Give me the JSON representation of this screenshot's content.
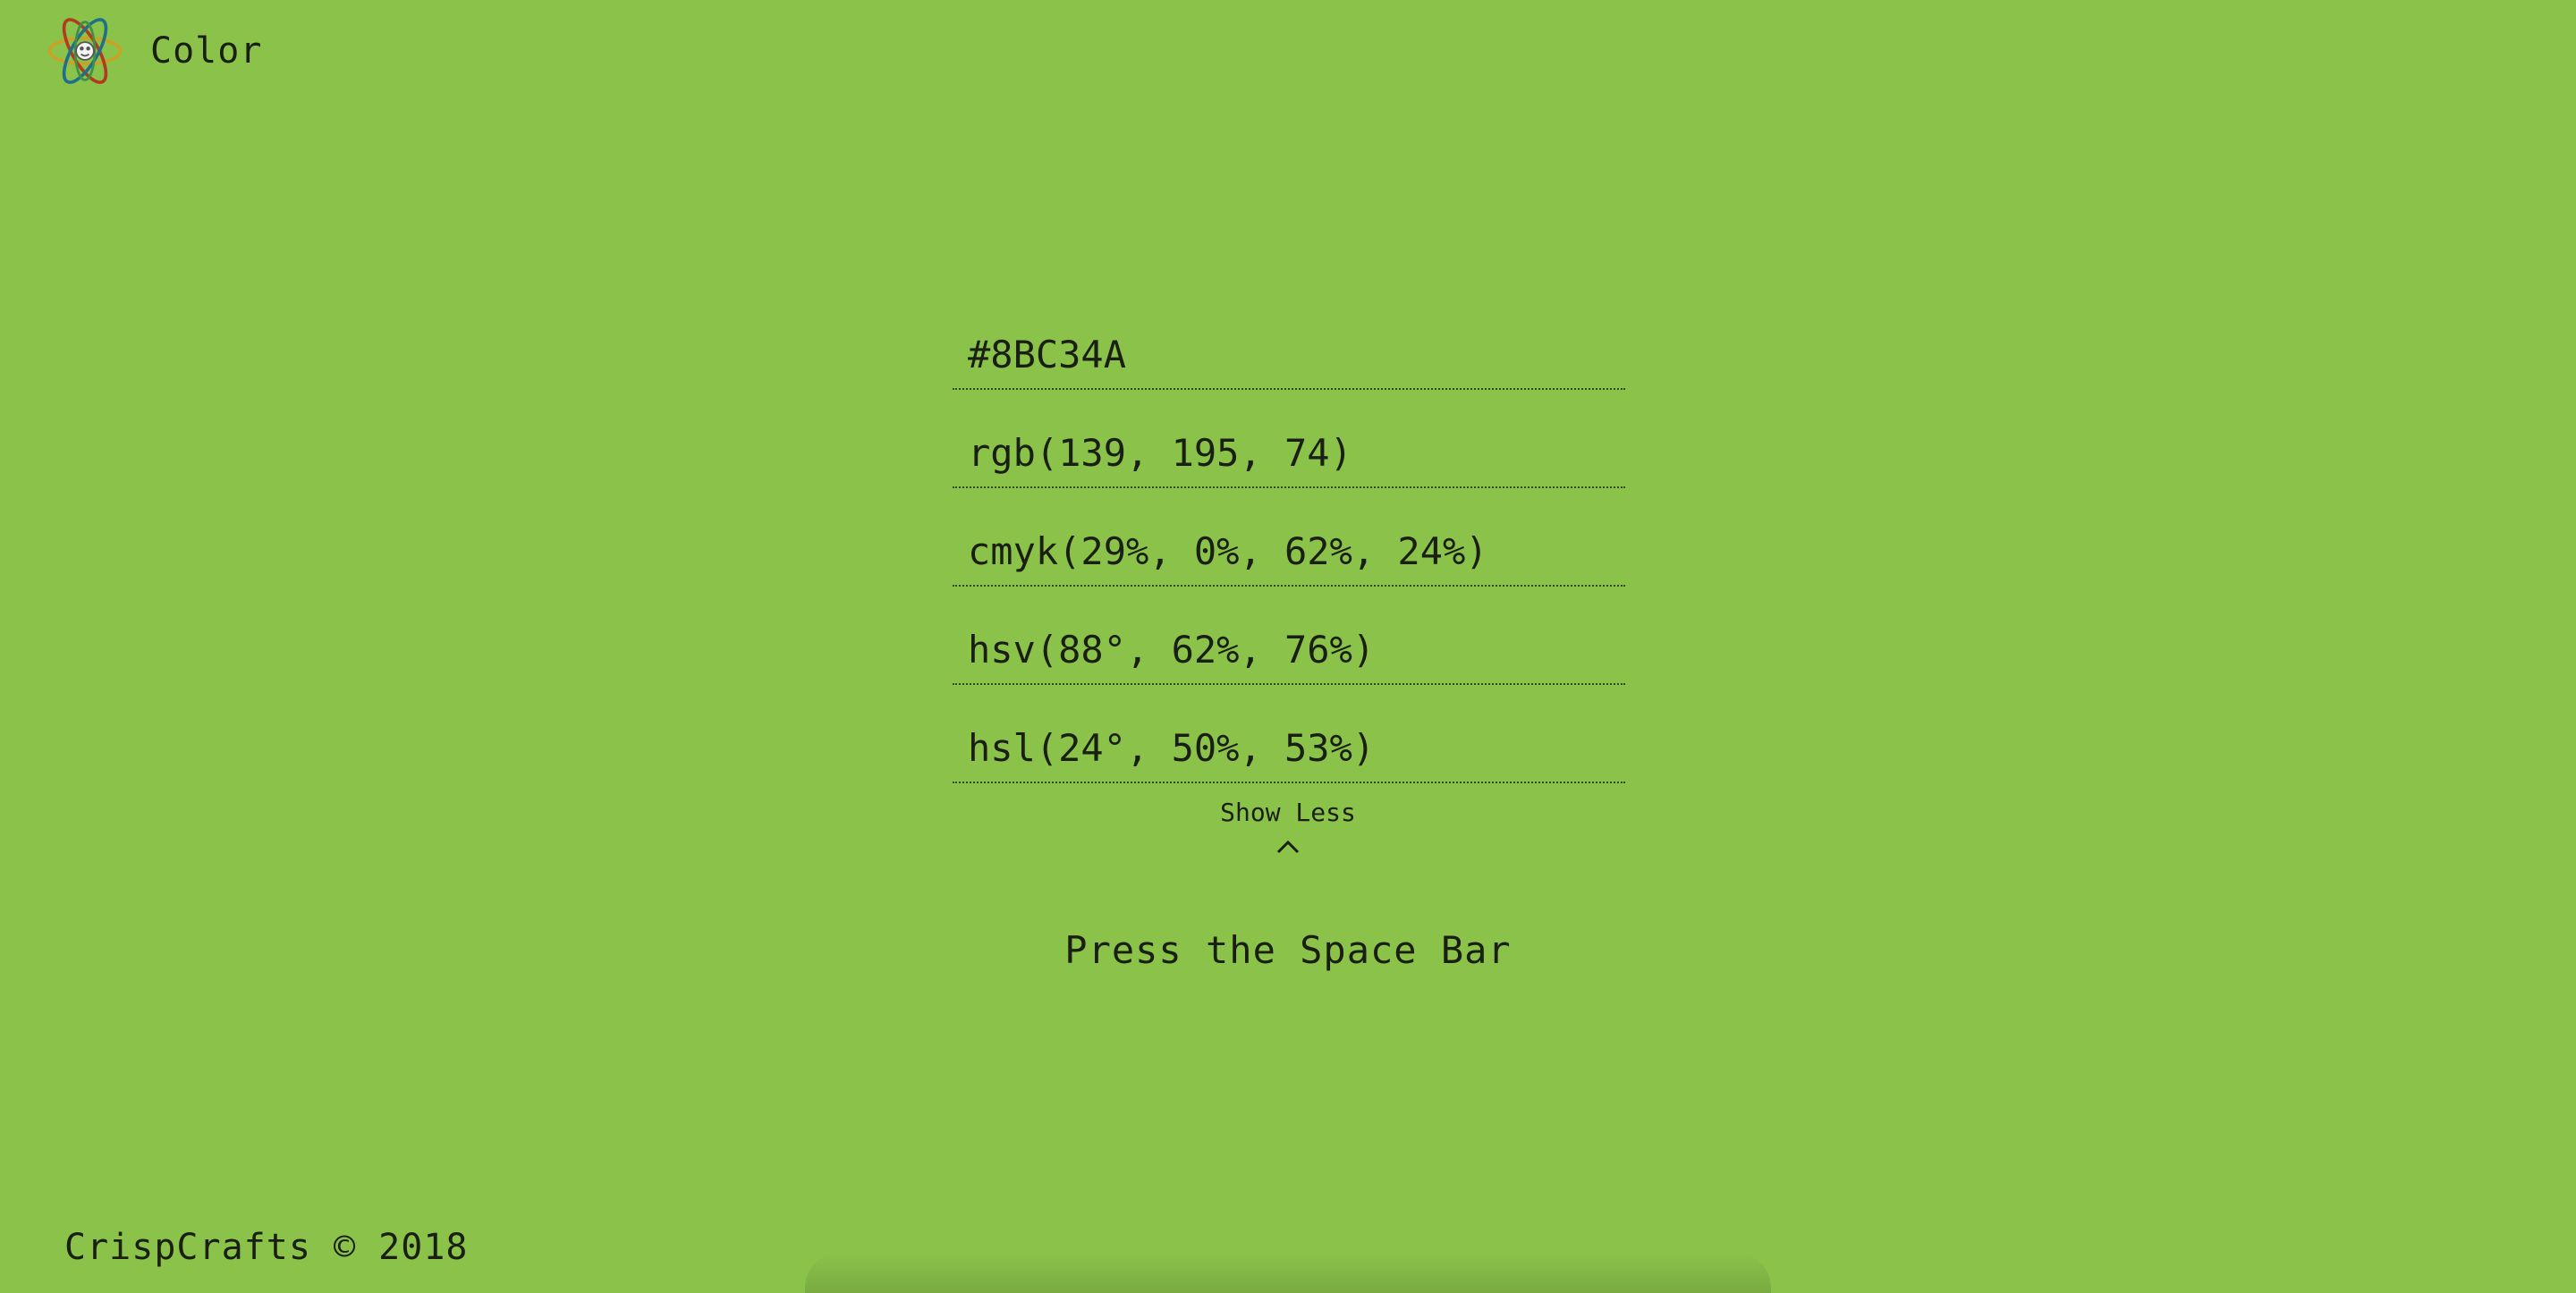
{
  "header": {
    "logo_icon": "atom-logo-icon",
    "title": "Color"
  },
  "formats": [
    {
      "value": "#8BC34A"
    },
    {
      "value": "rgb(139, 195, 74)"
    },
    {
      "value": "cmyk(29%, 0%, 62%, 24%)"
    },
    {
      "value": "hsv(88°, 62%, 76%)"
    },
    {
      "value": "hsl(24°, 50%, 53%)"
    }
  ],
  "toggle": {
    "label": "Show Less",
    "icon": "chevron-up-icon"
  },
  "hint": "Press the Space Bar",
  "footer": {
    "text": "CrispCrafts © 2018"
  },
  "colors": {
    "background": "#8BC34A",
    "text": "#1a1f14"
  }
}
